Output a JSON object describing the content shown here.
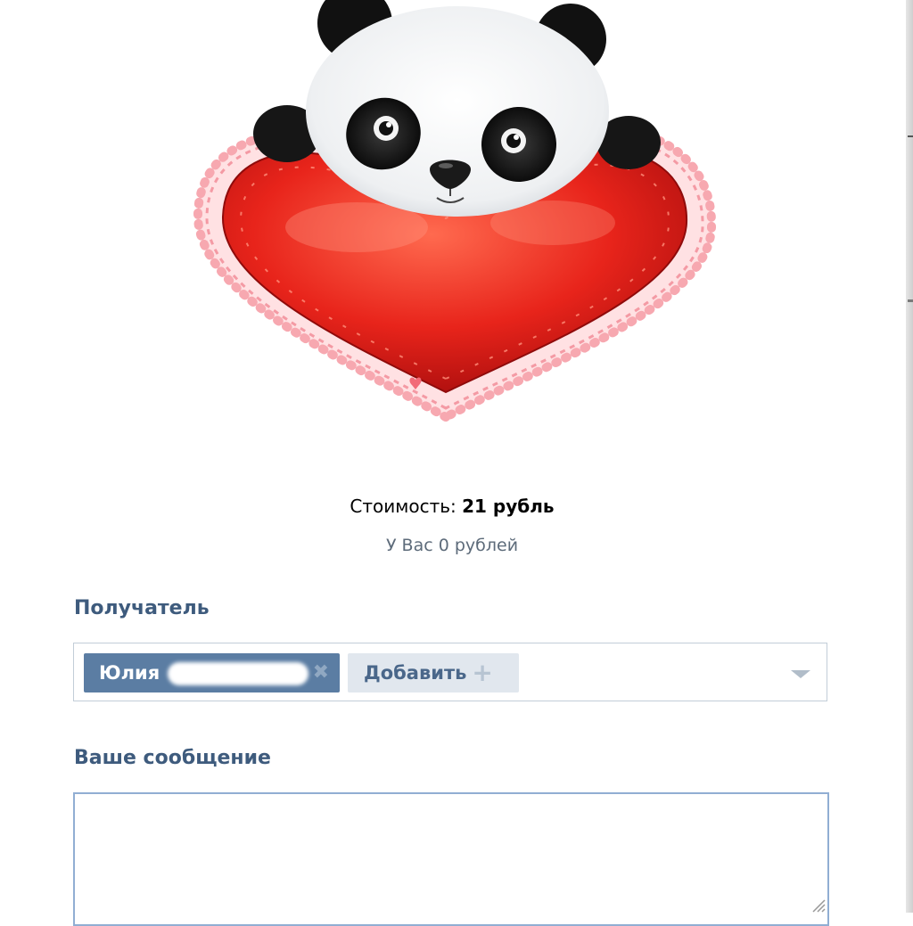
{
  "gift": {
    "price_label": "Стоимость:",
    "price_value": "21 рубль",
    "balance": "У Вас 0 рублей"
  },
  "recipient": {
    "label": "Получатель",
    "token_name": "Юлия",
    "add_label": "Добавить"
  },
  "message": {
    "label": "Ваше сообщение",
    "value": ""
  },
  "colors": {
    "heading": "#3e5b7d",
    "token_bg": "#5b7da3",
    "add_bg": "#e1e7ee",
    "input_border": "#c2cdd8",
    "focus_border": "#91aed3"
  },
  "icons": [
    "token-remove-icon",
    "plus-icon",
    "dropdown-arrow-icon",
    "resize-grip-icon"
  ]
}
